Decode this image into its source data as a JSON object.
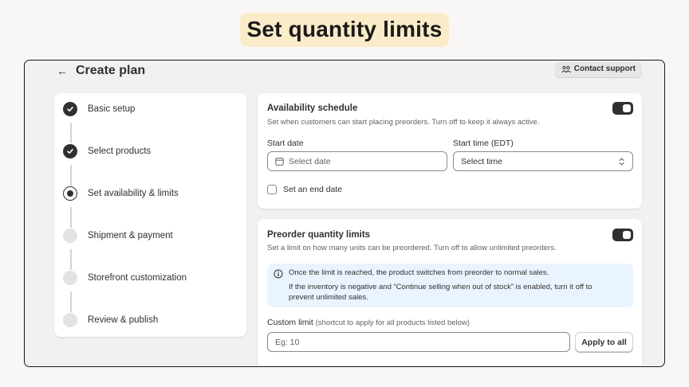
{
  "headline": "Set quantity limits",
  "topbar": {
    "back_icon": "arrow-left-icon",
    "title": "Create plan",
    "contact_label": "Contact support"
  },
  "steps": [
    {
      "label": "Basic setup",
      "state": "done"
    },
    {
      "label": "Select products",
      "state": "done"
    },
    {
      "label": "Set availability & limits",
      "state": "current"
    },
    {
      "label": "Shipment & payment",
      "state": "todo"
    },
    {
      "label": "Storefront customization",
      "state": "todo"
    },
    {
      "label": "Review & publish",
      "state": "todo"
    }
  ],
  "availability": {
    "title": "Availability schedule",
    "description": "Set when customers can start placing preorders. Turn off to keep it always active.",
    "toggle_on": true,
    "start_date_label": "Start date",
    "start_date_placeholder": "Select date",
    "start_time_label": "Start time (EDT)",
    "start_time_value": "Select time",
    "end_date_label": "Set an end date",
    "end_date_checked": false
  },
  "limits": {
    "title": "Preorder quantity limits",
    "description": "Set a limit on how many units can be preordered. Turn off to allow unlimited preorders.",
    "toggle_on": true,
    "banner_line1": "Once the limit is reached, the product switches from preorder to normal sales.",
    "banner_line2": "If the inventory is negative and “Continue selling when out of stock” is enabled, turn it off to",
    "banner_line3": "prevent unlimited sales.",
    "custom_limit_label": "Custom limit",
    "custom_limit_hint": "(shortcut to apply for all products listed below)",
    "custom_limit_placeholder": "Eg: 10",
    "apply_label": "Apply to all"
  },
  "colors": {
    "headline_bg": "#fbecc9",
    "banner_bg": "#eaf4ff",
    "toggle_on": "#303030"
  }
}
